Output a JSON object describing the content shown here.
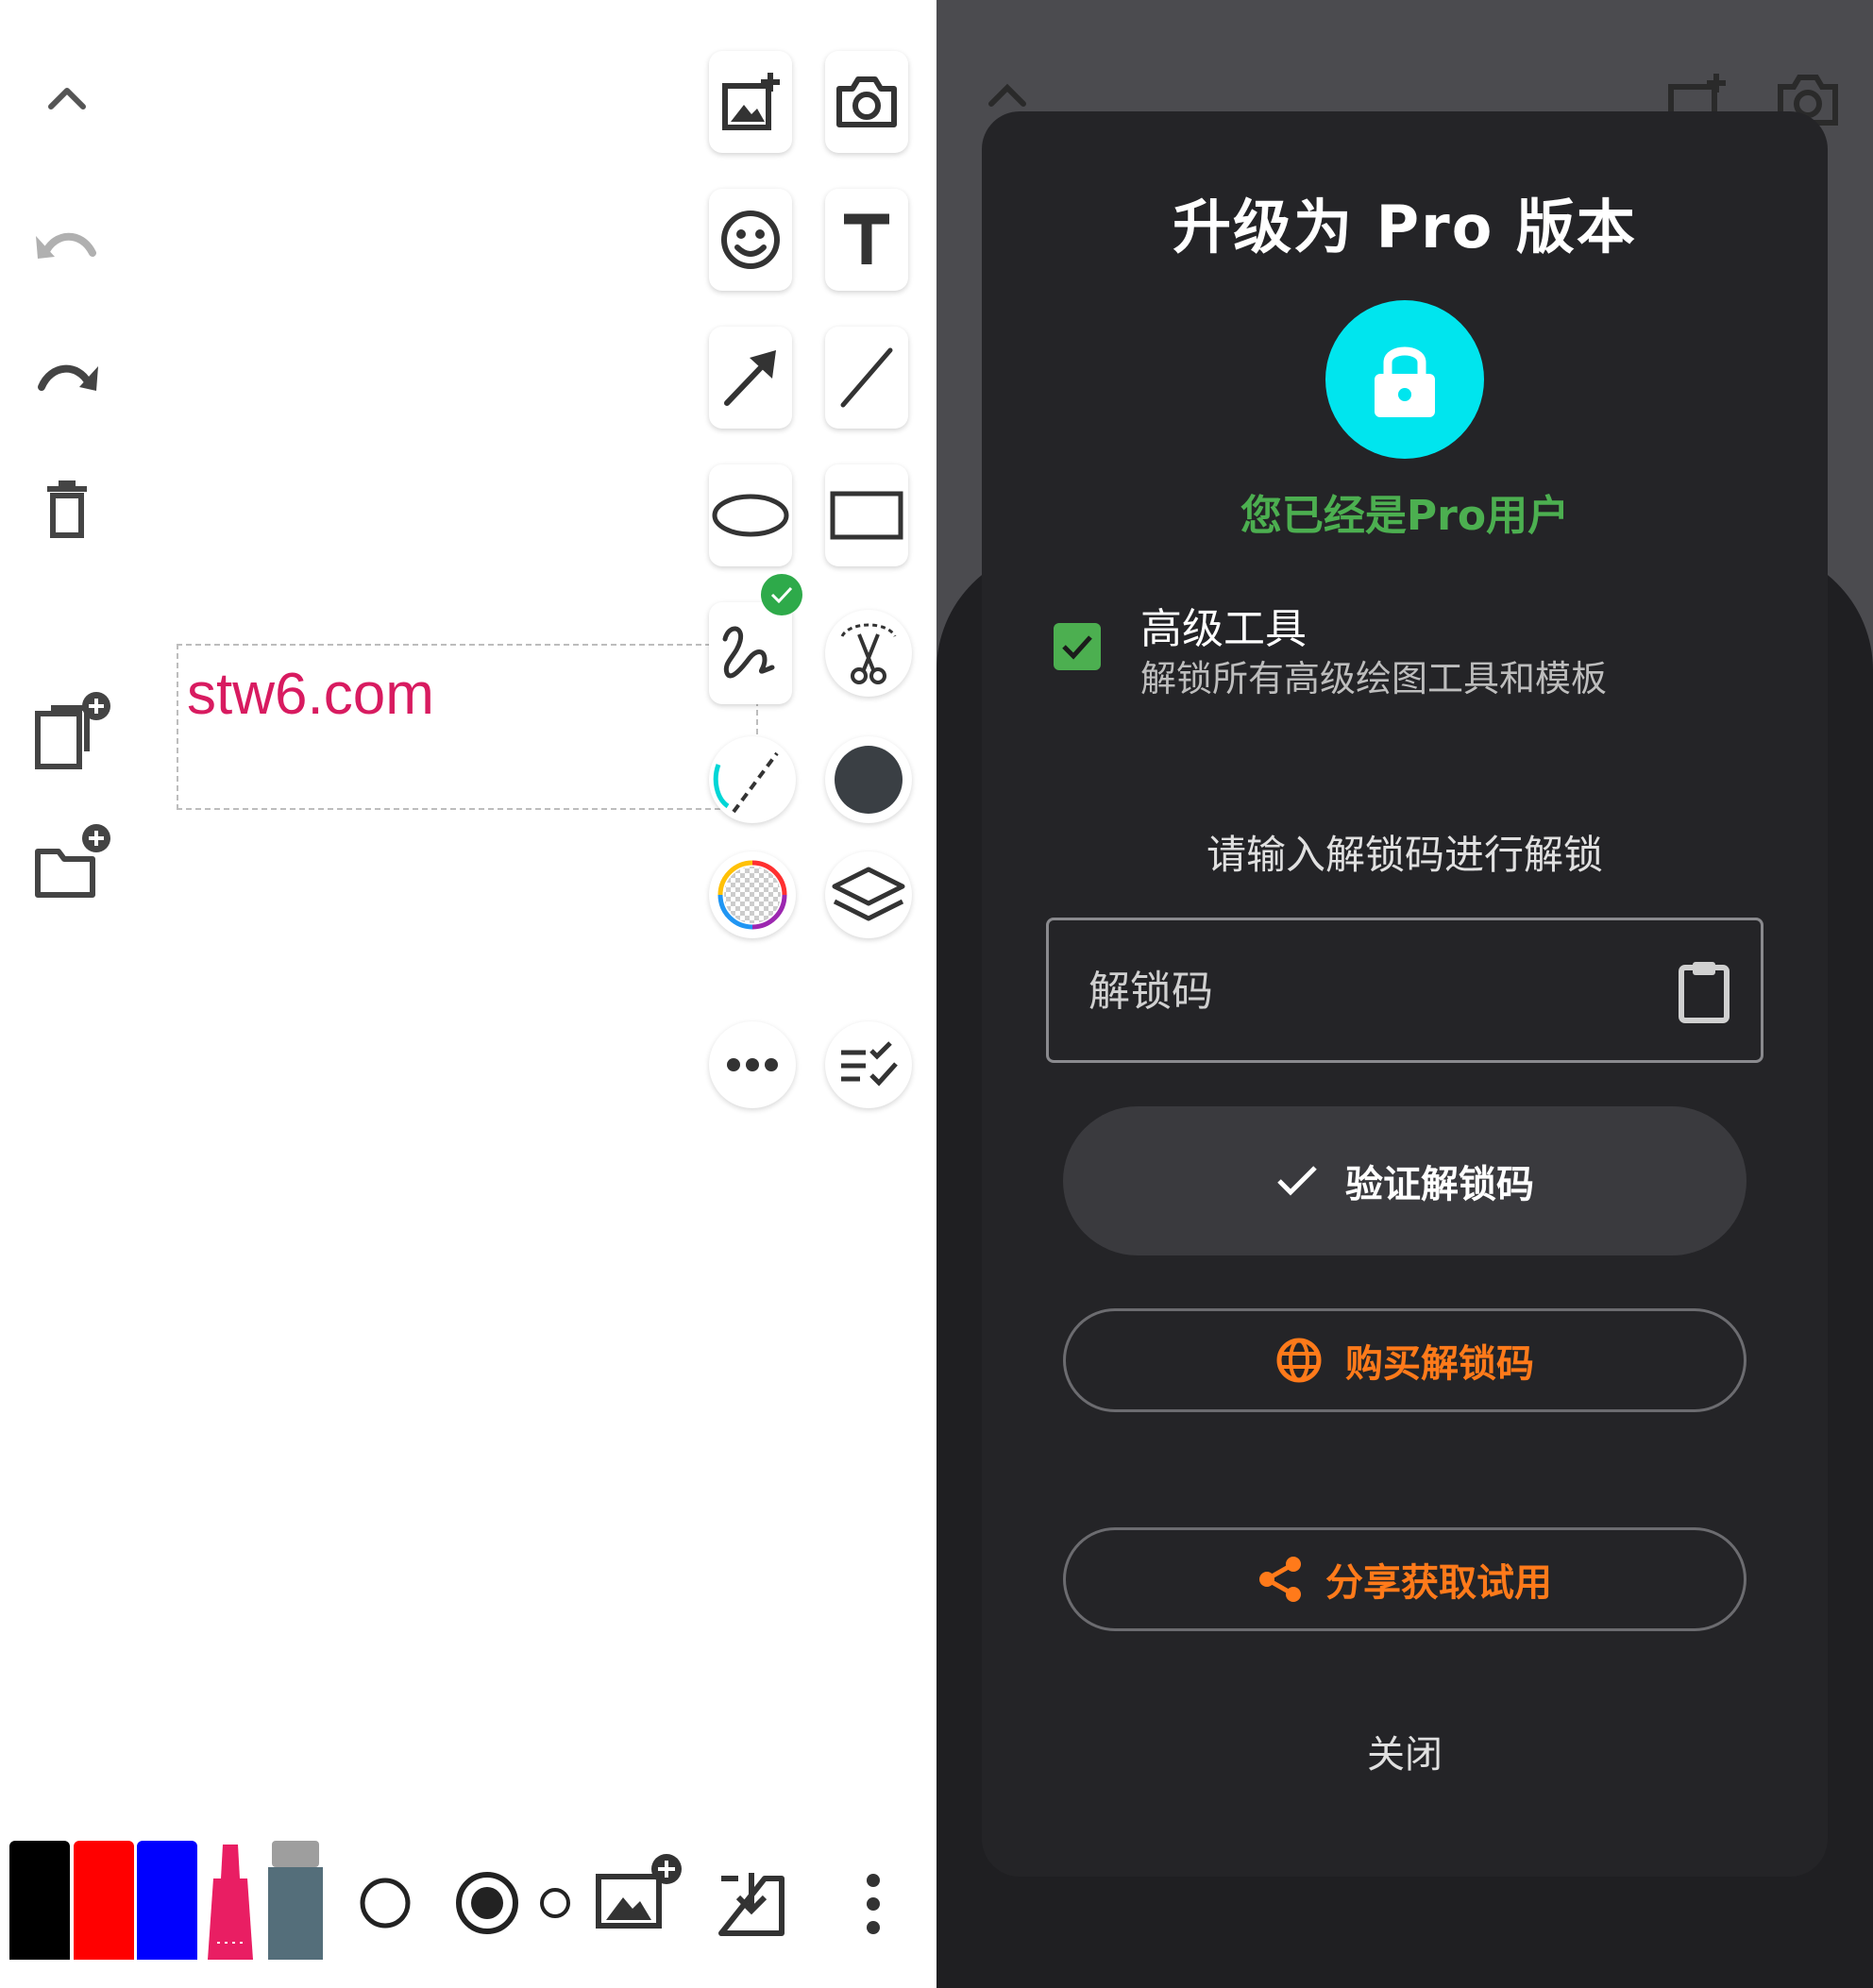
{
  "canvas": {
    "text": "stw6.com"
  },
  "left_sidebar": {
    "items": [
      "collapse",
      "undo",
      "redo",
      "delete",
      "new-page",
      "new-folder"
    ]
  },
  "toolbar": {
    "tools": [
      "add-image",
      "camera",
      "emoji",
      "text",
      "arrow",
      "line",
      "ellipse",
      "rectangle",
      "freehand",
      "lasso-cut",
      "dashed-stroke",
      "fill-color",
      "color-picker",
      "layers",
      "more",
      "checklist"
    ],
    "selected_tool": "freehand"
  },
  "bottom_bar": {
    "pens": [
      {
        "name": "black",
        "color": "#000000"
      },
      {
        "name": "red",
        "color": "#ff0000"
      },
      {
        "name": "blue",
        "color": "#0000ff"
      }
    ],
    "highlighter_color": "#e91e63",
    "eraser_color": "#546e7a"
  },
  "dialog": {
    "title": "升级为 Pro 版本",
    "status": "您已经是Pro用户",
    "feature": {
      "title": "高级工具",
      "description": "解锁所有高级绘图工具和模板",
      "checked": true
    },
    "prompt": "请输入解锁码进行解锁",
    "code_field": {
      "placeholder": "解锁码",
      "value": ""
    },
    "verify_label": "验证解锁码",
    "buy_label": "购买解锁码",
    "share_label": "分享获取试用",
    "close_label": "关闭",
    "colors": {
      "accent": "#ff7a1a",
      "success": "#4caf50",
      "lock": "#00e5ee"
    }
  }
}
